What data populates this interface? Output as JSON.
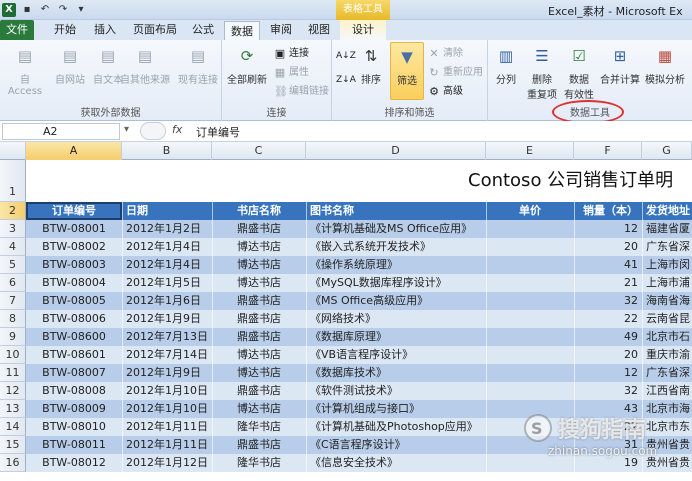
{
  "window": {
    "title": "Excel_素材 - Microsoft Ex",
    "context_tab_group": "表格工具"
  },
  "tabs": [
    {
      "label": "文件"
    },
    {
      "label": "开始"
    },
    {
      "label": "插入"
    },
    {
      "label": "页面布局"
    },
    {
      "label": "公式"
    },
    {
      "label": "数据"
    },
    {
      "label": "审阅"
    },
    {
      "label": "视图"
    },
    {
      "label": "设计"
    }
  ],
  "ribbon": {
    "get_external": {
      "label": "获取外部数据",
      "buttons": [
        "自 Access",
        "自网站",
        "自文本",
        "自其他来源",
        "现有连接"
      ]
    },
    "connections": {
      "label": "连接",
      "refresh_all": "全部刷新",
      "connections": "连接",
      "properties": "属性",
      "edit_links": "编辑链接"
    },
    "sort_filter": {
      "label": "排序和筛选",
      "sort": "排序",
      "filter": "筛选",
      "clear": "清除",
      "reapply": "重新应用",
      "advanced": "高级"
    },
    "data_tools": {
      "label": "数据工具",
      "text_to_columns": "分列",
      "remove_dup_1": "删除",
      "remove_dup_2": "重复项",
      "validation_1": "数据",
      "validation_2": "有效性",
      "consolidate": "合并计算",
      "what_if": "模拟分析"
    }
  },
  "formula_bar": {
    "name_box": "A2",
    "fx": "fx",
    "content": "订单编号"
  },
  "columns": [
    "A",
    "B",
    "C",
    "D",
    "E",
    "F",
    "G"
  ],
  "selected_column": "A",
  "rows": [
    "1",
    "2",
    "3",
    "4",
    "5",
    "6",
    "7",
    "8",
    "9",
    "10",
    "11",
    "12",
    "13",
    "14",
    "15",
    "16"
  ],
  "selected_row": "2",
  "sheet": {
    "title": "Contoso 公司销售订单明",
    "headers": [
      "订单编号",
      "日期",
      "书店名称",
      "图书名称",
      "单价",
      "销量（本）",
      "发货地址"
    ],
    "data": [
      [
        "BTW-08001",
        "2012年1月2日",
        "鼎盛书店",
        "《计算机基础及MS Office应用》",
        "",
        "12",
        "福建省厦"
      ],
      [
        "BTW-08002",
        "2012年1月4日",
        "博达书店",
        "《嵌入式系统开发技术》",
        "",
        "20",
        "广东省深"
      ],
      [
        "BTW-08003",
        "2012年1月4日",
        "博达书店",
        "《操作系统原理》",
        "",
        "41",
        "上海市闵"
      ],
      [
        "BTW-08004",
        "2012年1月5日",
        "博达书店",
        "《MySQL数据库程序设计》",
        "",
        "21",
        "上海市浦"
      ],
      [
        "BTW-08005",
        "2012年1月6日",
        "鼎盛书店",
        "《MS Office高级应用》",
        "",
        "32",
        "海南省海"
      ],
      [
        "BTW-08006",
        "2012年1月9日",
        "鼎盛书店",
        "《网络技术》",
        "",
        "22",
        "云南省昆"
      ],
      [
        "BTW-08600",
        "2012年7月13日",
        "鼎盛书店",
        "《数据库原理》",
        "",
        "49",
        "北京市石"
      ],
      [
        "BTW-08601",
        "2012年7月14日",
        "博达书店",
        "《VB语言程序设计》",
        "",
        "20",
        "重庆市渝"
      ],
      [
        "BTW-08007",
        "2012年1月9日",
        "博达书店",
        "《数据库技术》",
        "",
        "12",
        "广东省深"
      ],
      [
        "BTW-08008",
        "2012年1月10日",
        "鼎盛书店",
        "《软件测试技术》",
        "",
        "32",
        "江西省南"
      ],
      [
        "BTW-08009",
        "2012年1月10日",
        "博达书店",
        "《计算机组成与接口》",
        "",
        "43",
        "北京市海"
      ],
      [
        "BTW-08010",
        "2012年1月11日",
        "隆华书店",
        "《计算机基础及Photoshop应用》",
        "",
        "22",
        "北京市东"
      ],
      [
        "BTW-08011",
        "2012年1月11日",
        "鼎盛书店",
        "《C语言程序设计》",
        "",
        "31",
        "贵州省贵"
      ],
      [
        "BTW-08012",
        "2012年1月12日",
        "隆华书店",
        "《信息安全技术》",
        "",
        "19",
        "贵州省贵"
      ]
    ]
  },
  "watermark": {
    "brand": "搜狗指南",
    "url": "zhinan.sogou.com"
  },
  "colors": {
    "header_blue": "#3774bd",
    "row_dark": "#b8cde9",
    "row_light": "#dce7f4",
    "file_tab": "#2a7a3c",
    "annotation_red": "#e03030"
  }
}
